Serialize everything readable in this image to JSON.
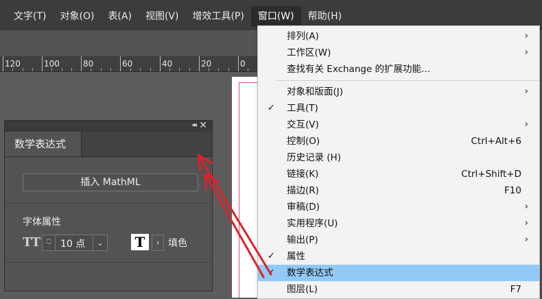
{
  "menubar": {
    "items": [
      {
        "label": "文字(T)"
      },
      {
        "label": "对象(O)"
      },
      {
        "label": "表(A)"
      },
      {
        "label": "视图(V)"
      },
      {
        "label": "增效工具(P)"
      },
      {
        "label": "窗口(W)"
      },
      {
        "label": "帮助(H)"
      }
    ]
  },
  "ruler": {
    "labels": [
      "120",
      "100",
      "80",
      "60",
      "40",
      "20",
      "0"
    ]
  },
  "panel": {
    "tab_label": "数学表达式",
    "insert_button": "插入 MathML",
    "font_props_label": "字体属性",
    "size_icon_text": "TT",
    "font_size_value": "10 点",
    "fill_swatch_glyph": "T",
    "fill_label": "填色"
  },
  "window_menu": {
    "items": [
      {
        "label": "排列(A)",
        "shortcut": "",
        "submenu": true,
        "checked": false
      },
      {
        "label": "工作区(W)",
        "shortcut": "",
        "submenu": true,
        "checked": false
      },
      {
        "label": "查找有关 Exchange 的扩展功能...",
        "shortcut": "",
        "submenu": false,
        "checked": false
      },
      {
        "label": "对象和版面(J)",
        "shortcut": "",
        "submenu": true,
        "checked": false
      },
      {
        "label": "工具(T)",
        "shortcut": "",
        "submenu": false,
        "checked": true
      },
      {
        "label": "交互(V)",
        "shortcut": "",
        "submenu": true,
        "checked": false
      },
      {
        "label": "控制(O)",
        "shortcut": "Ctrl+Alt+6",
        "submenu": false,
        "checked": false
      },
      {
        "label": "历史记录 (H)",
        "shortcut": "",
        "submenu": false,
        "checked": false
      },
      {
        "label": "链接(K)",
        "shortcut": "Ctrl+Shift+D",
        "submenu": false,
        "checked": false
      },
      {
        "label": "描边(R)",
        "shortcut": "F10",
        "submenu": false,
        "checked": false
      },
      {
        "label": "审稿(D)",
        "shortcut": "",
        "submenu": true,
        "checked": false
      },
      {
        "label": "实用程序(U)",
        "shortcut": "",
        "submenu": true,
        "checked": false
      },
      {
        "label": "输出(P)",
        "shortcut": "",
        "submenu": true,
        "checked": false
      },
      {
        "label": "属性",
        "shortcut": "",
        "submenu": false,
        "checked": true
      },
      {
        "label": "数学表达式",
        "shortcut": "",
        "submenu": false,
        "checked": true,
        "highlighted": true
      },
      {
        "label": "图层(L)",
        "shortcut": "F7",
        "submenu": false,
        "checked": false
      }
    ],
    "check_glyph": "✓",
    "submenu_glyph": "›"
  },
  "colors": {
    "menu_highlight": "#91c9f7",
    "annotation_arrow": "#e0202a",
    "page_margin_guide": "#d84a6a"
  }
}
